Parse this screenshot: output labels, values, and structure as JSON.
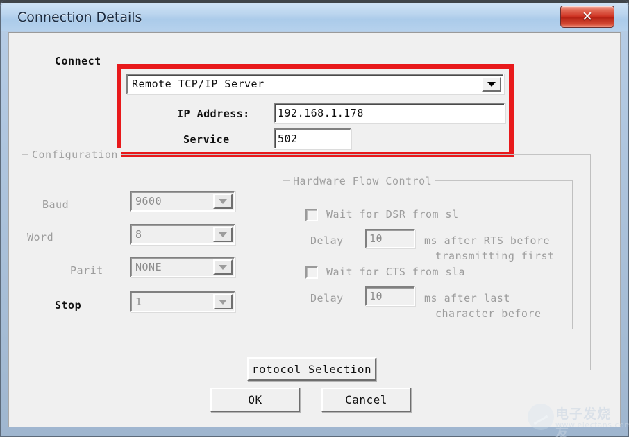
{
  "window": {
    "title": "Connection Details",
    "close_label": "✕"
  },
  "connect": {
    "label": "Connect",
    "type_value": "Remote TCP/IP Server",
    "ip_label": "IP Address:",
    "ip_value": "192.168.1.178",
    "service_label": "Service",
    "service_value": "502",
    "highlight_color": "#e8191b"
  },
  "configuration": {
    "title": "Configuration",
    "rows": [
      {
        "label": "Baud",
        "value": "9600",
        "enabled": false
      },
      {
        "label": "Word",
        "value": "8",
        "enabled": false
      },
      {
        "label": "Parit",
        "value": "NONE",
        "enabled": false
      },
      {
        "label": "Stop",
        "value": "1",
        "enabled": true
      }
    ]
  },
  "flow_control": {
    "title": "Hardware Flow Control",
    "dsr_checkbox_label": "Wait for DSR from sl",
    "dsr_delay_label": "Delay",
    "dsr_delay_value": "10",
    "dsr_delay_suffix_line1": "ms after RTS before",
    "dsr_delay_suffix_line2": "transmitting first",
    "cts_checkbox_label": "Wait for CTS from sla",
    "cts_delay_label": "Delay",
    "cts_delay_value": "10",
    "cts_delay_suffix_line1": "ms after last",
    "cts_delay_suffix_line2": "character before"
  },
  "buttons": {
    "protocol": "rotocol Selection",
    "ok": "OK",
    "cancel": "Cancel"
  },
  "watermark": {
    "text": "电子发烧友",
    "url": "www.elecfans.com"
  }
}
